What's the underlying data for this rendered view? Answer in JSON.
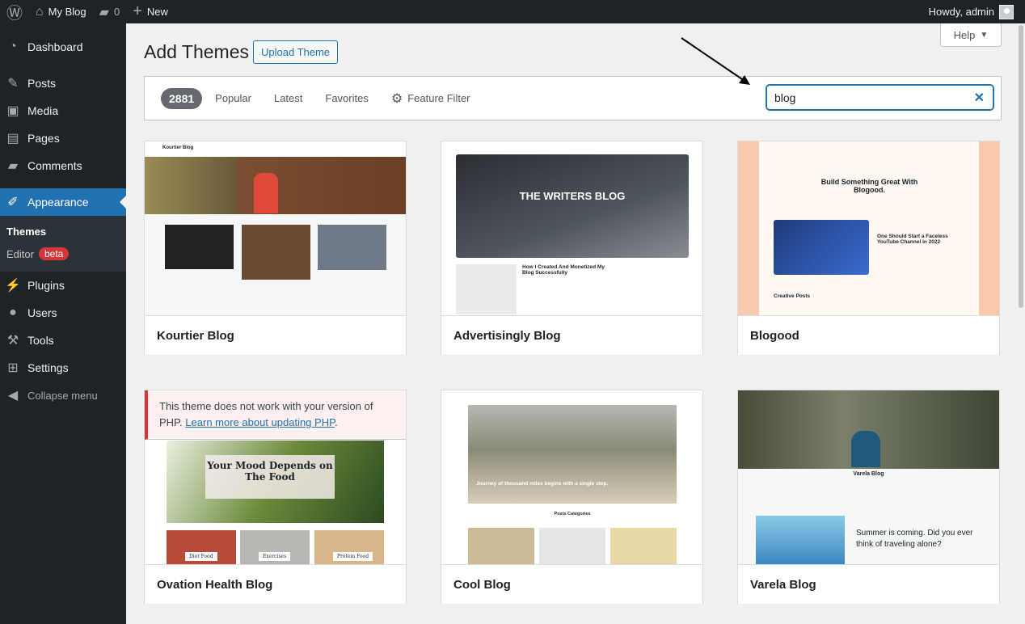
{
  "adminbar": {
    "site": "My Blog",
    "comments": "0",
    "new": "New",
    "howdy": "Howdy, admin"
  },
  "sidebar": {
    "items": [
      {
        "label": "Dashboard",
        "icon": "dashboard-icon"
      },
      {
        "label": "Posts",
        "icon": "pin-icon"
      },
      {
        "label": "Media",
        "icon": "media-icon"
      },
      {
        "label": "Pages",
        "icon": "pages-icon"
      },
      {
        "label": "Comments",
        "icon": "comment-icon"
      },
      {
        "label": "Appearance",
        "icon": "brush-icon",
        "active": true
      },
      {
        "label": "Plugins",
        "icon": "plugin-icon"
      },
      {
        "label": "Users",
        "icon": "user-icon"
      },
      {
        "label": "Tools",
        "icon": "wrench-icon"
      },
      {
        "label": "Settings",
        "icon": "settings-icon"
      },
      {
        "label": "Collapse menu",
        "icon": "collapse-icon"
      }
    ],
    "submenu": {
      "themes": "Themes",
      "editor": "Editor",
      "beta": "beta"
    }
  },
  "page": {
    "title": "Add Themes",
    "upload": "Upload Theme",
    "help": "Help"
  },
  "filter": {
    "count": "2881",
    "tabs": [
      "Popular",
      "Latest",
      "Favorites"
    ],
    "feature": "Feature Filter",
    "search_value": "blog"
  },
  "themes": [
    {
      "name": "Kourtier Blog",
      "preview": {
        "site": "Kourtier Blog"
      }
    },
    {
      "name": "Advertisingly Blog",
      "preview": {
        "headline": "THE WRITERS BLOG",
        "sub": "How I Created And Monetized My Blog Successfully"
      }
    },
    {
      "name": "Blogood",
      "preview": {
        "headline": "Build Something Great With Blogood.",
        "post": "One Should Start a Faceless YouTube Channel in 2022",
        "section": "Creative Posts"
      }
    },
    {
      "name": "Ovation Health Blog",
      "notice": "This theme does not work with your version of PHP.",
      "notice_link": "Learn more about updating PHP",
      "preview": {
        "headline": "Your Mood Depends on The Food",
        "cats": [
          "Diet Food",
          "Exercises",
          "Protein Food"
        ]
      }
    },
    {
      "name": "Cool Blog",
      "preview": {
        "headline": "Journey of thousand miles begins with a single step.",
        "section": "Posts Categories"
      }
    },
    {
      "name": "Varela Blog",
      "preview": {
        "site": "Varela Blog",
        "headline": "Summer is coming. Did you ever think of traveling alone?"
      }
    }
  ],
  "colors": {
    "accent": "#2271b1",
    "adminbar": "#1d2327",
    "error": "#d63638"
  }
}
